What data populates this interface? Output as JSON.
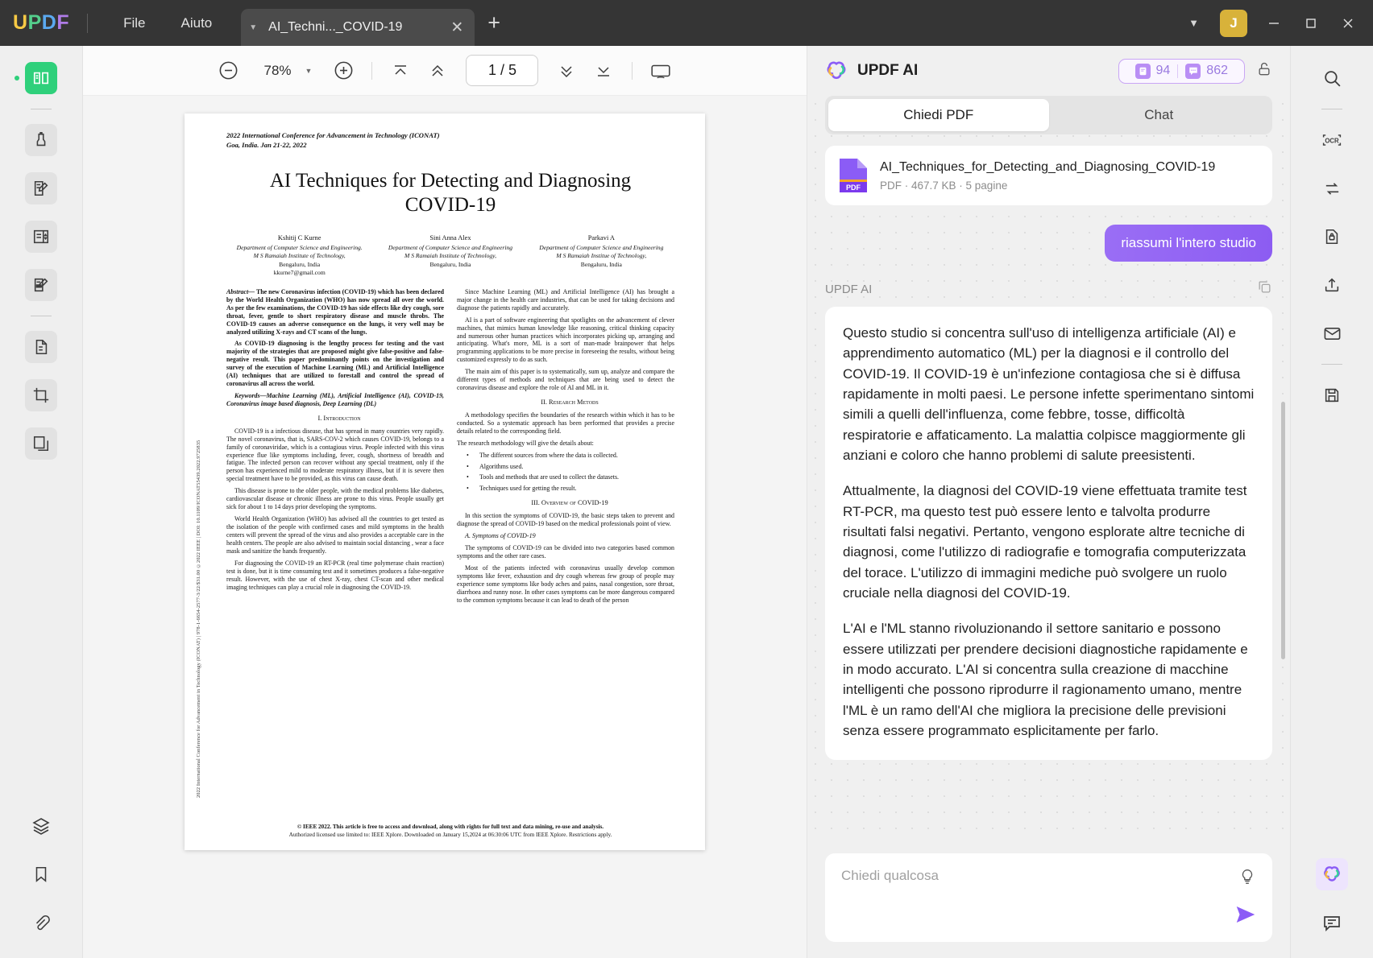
{
  "titlebar": {
    "logo_letters": [
      "U",
      "P",
      "D",
      "F"
    ],
    "menus": [
      "File",
      "Aiuto"
    ],
    "tab_title": "AI_Techni..._COVID-19",
    "avatar_initial": "J"
  },
  "toolbar": {
    "zoom_level": "78%",
    "page_indicator": "1 / 5"
  },
  "left_rail": [
    {
      "name": "reader-icon",
      "label": "Lettore"
    },
    {
      "name": "highlighter-icon",
      "label": "Commento"
    },
    {
      "name": "edit-pdf-icon",
      "label": "Modifica PDF"
    },
    {
      "name": "form-icon",
      "label": "Modulo"
    },
    {
      "name": "sign-icon",
      "label": "Firma"
    },
    {
      "name": "convert-icon",
      "label": "Converti"
    },
    {
      "name": "crop-icon",
      "label": "Ritaglia"
    },
    {
      "name": "organize-pages-icon",
      "label": "Organizza pagine"
    },
    {
      "name": "layers-icon",
      "label": "Livelli"
    },
    {
      "name": "bookmark-icon",
      "label": "Segnalibro"
    },
    {
      "name": "attachment-icon",
      "label": "Allegato"
    }
  ],
  "right_rail": [
    {
      "name": "search-icon",
      "label": "Cerca"
    },
    {
      "name": "ocr-icon",
      "label": "OCR"
    },
    {
      "name": "compare-icon",
      "label": "Confronta"
    },
    {
      "name": "protect-icon",
      "label": "Proteggi"
    },
    {
      "name": "share-icon",
      "label": "Condividi"
    },
    {
      "name": "email-icon",
      "label": "Email"
    },
    {
      "name": "save-as-icon",
      "label": "Salva con nome"
    },
    {
      "name": "updf-ai-icon",
      "label": "UPDF AI"
    },
    {
      "name": "comment-icon",
      "label": "Commenti"
    }
  ],
  "ai_panel": {
    "title": "UPDF AI",
    "credits": {
      "doc_count": "94",
      "chat_count": "862"
    },
    "tabs": [
      {
        "label": "Chiedi PDF",
        "selected": true
      },
      {
        "label": "Chat",
        "selected": false
      }
    ],
    "file_card": {
      "name": "AI_Techniques_for_Detecting_and_Diagnosing_COVID-19",
      "meta": "PDF · 467.7 KB · 5 pagine",
      "badge": "PDF"
    },
    "user_message": "riassumi l'intero studio",
    "assistant_label": "UPDF AI",
    "assistant_paragraphs": [
      "Questo studio si concentra sull'uso di intelligenza artificiale (AI) e apprendimento automatico (ML) per la diagnosi e il controllo del COVID-19. Il COVID-19 è un'infezione contagiosa che si è diffusa rapidamente in molti paesi. Le persone infette sperimentano sintomi simili a quelli dell'influenza, come febbre, tosse, difficoltà respiratorie e affaticamento. La malattia colpisce maggiormente gli anziani e coloro che hanno problemi di salute preesistenti.",
      "Attualmente, la diagnosi del COVID-19 viene effettuata tramite test RT-PCR, ma questo test può essere lento e talvolta produrre risultati falsi negativi. Pertanto, vengono esplorate altre tecniche di diagnosi, come l'utilizzo di radiografie e tomografia computerizzata del torace. L'utilizzo di immagini mediche può svolgere un ruolo cruciale nella diagnosi del COVID-19.",
      "L'AI e l'ML stanno rivoluzionando il settore sanitario e possono essere utilizzati per prendere decisioni diagnostiche rapidamente e in modo accurato. L'AI si concentra sulla creazione di macchine intelligenti che possono riprodurre il ragionamento umano, mentre l'ML è un ramo dell'AI che migliora la precisione delle previsioni senza essere programmato esplicitamente per farlo."
    ],
    "input_placeholder": "Chiedi qualcosa"
  },
  "document": {
    "side_strip": "2022 International Conference for Advancement in Technology (ICONAT) | 978-1-6654-2577-3/22/$31.00 ©2022 IEEE | DOI: 10.1109/ICONAT55439.2022.9725835",
    "conference_line1": "2022 International Conference for Advancement in Technology (ICONAT)",
    "conference_line2": "Goa, India. Jan 21-22, 2022",
    "title": "AI Techniques for Detecting and Diagnosing COVID-19",
    "authors": [
      {
        "name": "Kshitij C Kurne",
        "dept": "Department of Computer Science and Engineering.",
        "inst": "M S Ramaiah Institute of Technology,",
        "city": "Bengaluru, India",
        "email": "kkurne7@gmail.com"
      },
      {
        "name": "Sini Anna Alex",
        "dept": "Department of Computer Science and Engineering",
        "inst": "M S Ramaiah Institute of Technology,",
        "city": "Bengaluru, India",
        "email": ""
      },
      {
        "name": "Parkavi A",
        "dept": "Department of Computer Science and Engineering",
        "inst": "M S Ramaiah Institue of Technology,",
        "city": "Bengaluru, India",
        "email": ""
      }
    ],
    "abstract_label": "Abstract—",
    "abstract_p1": "The new Coronavirus infection (COVID-19) which has been declared by the World Health Organization (WHO) has now spread all over the world. As per the few examinations, the COVID-19 has side effects like dry cough, sore throat, fever, gentle to short respiratory disease and muscle throbs. The COVID-19 causes an adverse consequence on the lungs, it very well may be analyzed utilizing X-rays and CT scans of the lungs.",
    "abstract_p2": "As COVID-19 diagnosing is the lengthy process for testing and the vast majority of the strategies that are proposed might give false-positive and false-negative result. This paper predominantly points on the investigation and survey of the execution of Machine Learning (ML) and Artificial Intelligence (AI) techniques that are utilized to forestall and control the spread of coronavirus all across the world.",
    "keywords": "Keywords—Machine Learning (ML), Artificial Intelligence (AI), COVID-19, Coronavirus image based diagnosis, Deep Learning (DL)",
    "sec1": "I.    Introduction",
    "intro_p1": "COVID-19 is a infectious disease, that has spread in many countries very rapidly. The novel coronavirus, that is, SARS-COV-2 which causes COVID-19, belongs to a family of coronaviridae, which is a contagious virus. People infected with this virus experience flue like symptoms including, fever, cough, shortness of breadth and fatigue. The infected person can recover without any special treatment, only if the person has experienced mild to moderate respiratory illness, but if it is severe then special treatment have to be provided, as this virus can cause death.",
    "intro_p2": "This disease is prone to the older people, with the medical problems like diabetes, cardiovascular disease or chronic illness are prone to this virus. People usually get sick for about 1 to 14 days prior developing the symptoms.",
    "intro_p3": "World Health Organization (WHO) has advised all the countries to get tested as the isolation of the people with confirmed cases and mild symptoms in the health centers will prevent the spread of the virus and also provides a acceptable care in the health centers. The people are also advised to maintain social distancing , wear a face mask and sanitize the hands frequently.",
    "intro_p4": "For diagnosing the COVID-19 an RT-PCR (real time polymerase chain reaction) test is done, but it is time consuming test and it sometimes produces a false-negative result. However, with the use of chest X-ray, chest CT-scan and other medical imaging techniques can play a crucial role in diagnosing the COVID-19.",
    "rc_p1": "Since Machine Learning (ML) and Artificial Intelligence (AI) has brought a major change in the health care industries, that can be used for taking decisions and diagnose the patients rapidly and accurately.",
    "rc_p2": "AI is a part of software engineering that spotlights on the advancement of clever machines, that mimics human knowledge like reasoning, critical thinking capacity and numerous other human practices which incorporates picking up, arranging and anticipating. What's more, ML is a sort of man-made brainpower that helps programming applications to be more precise in foreseeing the results, without being customized expressly to do as such.",
    "rc_p3": "The main aim of this paper is to systematically, sum up, analyze and compare the different types of methods and techniques that are being used to detect the coronavirus disease and explore the role of AI and ML in it.",
    "sec2": "II.    Research Metods",
    "rm_p1": "A methodology specifies the boundaries of the research within which it has to be conducted. So a systematic approach has been performed that provides a precise details related to the corresponding field.",
    "rm_p2": "The research methodology will give the details about:",
    "rm_bullets": [
      "The different sources from where the data is collected.",
      "Algorithms used.",
      "Tools and methods that are used to collect the datasets.",
      "Techniques used for getting the result."
    ],
    "sec3": "III.    Overview of COVID-19",
    "ov_p1": "In this section the symptoms of COVID-19, the basic steps taken to prevent and diagnose the spread of COVID-19 based on the medical professionals point of view.",
    "subsec_a": "A.    Symptoms of COVID-19",
    "ov_p2": "The symptoms of COVID-19 can be divided into two categories based common symptoms and the other rare cases.",
    "ov_p3": "Most of the patients infected with coronavirus usually develop common symptoms like fever, exhaustion and dry cough whereas few group of people may experience some symptoms like body aches and pains, nasal congestion, sore throat, diarrhoea and runny nose. In other cases symptoms can be more dangerous compared to the common symptoms because it can lead to death of the person",
    "footer1": "© IEEE 2022. This article is free to access and download, along with rights for full text and data mining, re-use and analysis.",
    "footer2": "Authorized licensed use limited to: IEEE Xplore. Downloaded on January 15,2024 at 06:30:06 UTC from IEEE Xplore.  Restrictions apply."
  }
}
